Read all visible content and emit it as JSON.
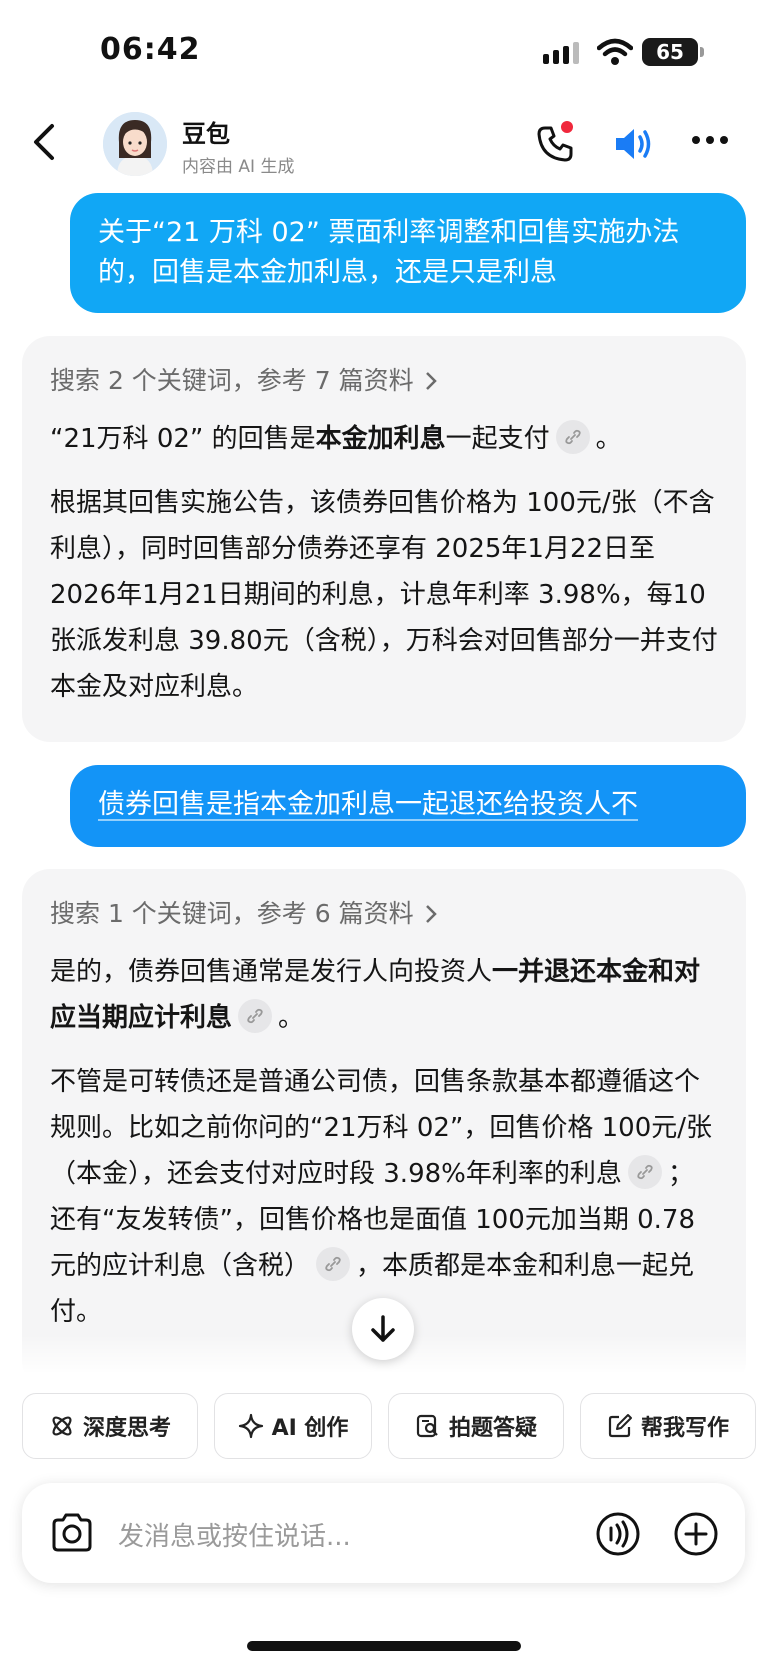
{
  "status_bar": {
    "time": "06:42",
    "battery": "65"
  },
  "header": {
    "bot_name": "豆包",
    "subtitle": "内容由 AI 生成"
  },
  "messages": [
    {
      "role": "user",
      "text": "关于“21 万科 02” 票面利率调整和回售实施办法的，回售是本金加利息，还是只是利息"
    },
    {
      "role": "assistant",
      "search": "搜索 2 个关键词，参考 7 篇资料",
      "p1_a": "“21万科 02” 的回售是",
      "p1_bold": "本金加利息",
      "p1_b": "一起支付",
      "p1_end": "。",
      "p2": "根据其回售实施公告，该债券回售价格为 100元/张（不含利息），同时回售部分债券还享有 2025年1月22日至 2026年1月21日期间的利息，计息年利率 3.98%，每10张派发利息 39.80元（含税），万科会对回售部分一并支付本金及对应利息。"
    },
    {
      "role": "user",
      "text": "债券回售是指本金加利息一起退还给投资人不"
    },
    {
      "role": "assistant",
      "search": "搜索 1 个关键词，参考 6 篇资料",
      "p1_a": "是的，债券回售通常是发行人向投资人",
      "p1_bold": "一并退还本金和对应当期应计利息",
      "p1_end": "。",
      "p2_a": "不管是可转债还是普通公司债，回售条款基本都遵循这个规则。比如之前你问的“21万科 02”，回售价格 100元/张（本金），还会支付对应时段 3.98%年利率的利息",
      "p2_b": "；还有“友发转债”，回售价格也是面值 100元加当期 0.78元的应计利息（含税）",
      "p2_c": "，本质都是本金和利息一起兑付。"
    }
  ],
  "quick_actions": [
    {
      "label": "深度思考",
      "icon": "atom-icon"
    },
    {
      "label": "AI 创作",
      "icon": "sparkle-icon"
    },
    {
      "label": "拍题答疑",
      "icon": "scan-question-icon"
    },
    {
      "label": "帮我写作",
      "icon": "edit-icon"
    }
  ],
  "input": {
    "placeholder": "发消息或按住说话..."
  },
  "colors": {
    "user_bubble": "#11a7f5",
    "user_bubble_2": "#1394f7",
    "card_bg": "#f5f5f6",
    "accent": "#1a7cf5",
    "call_dot": "#f0283c"
  }
}
